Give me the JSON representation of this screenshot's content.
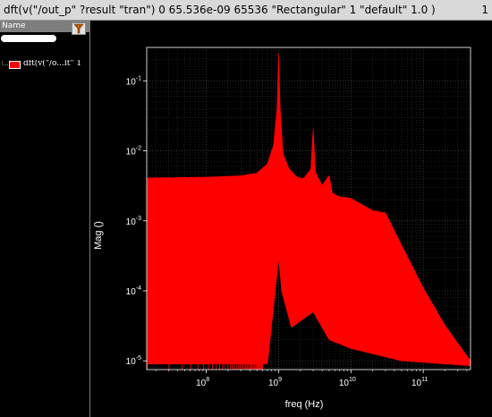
{
  "window": {
    "title": "dft(v(\"/out_p\" ?result \"tran\") 0 65.536e-09 65536 \"Rectangular\" 1 \"default\" 1.0 )",
    "number": "1"
  },
  "panel": {
    "header_label": "Name",
    "traces": [
      {
        "label": "dft(v(\"/o...lt\" 1",
        "color": "#ff0000"
      }
    ]
  },
  "chart_data": {
    "type": "line",
    "xlabel": "freq (Hz)",
    "ylabel": "Mag ()",
    "xscale": "log",
    "yscale": "log",
    "xlim": [
      15000000,
      450000000000
    ],
    "ylim": [
      7.5e-06,
      0.3
    ],
    "grid": true,
    "x_ticks": [
      {
        "value": 100000000,
        "base": "10",
        "exp": "8"
      },
      {
        "value": 1000000000,
        "base": "10",
        "exp": "9"
      },
      {
        "value": 10000000000,
        "base": "10",
        "exp": "10"
      },
      {
        "value": 100000000000,
        "base": "10",
        "exp": "11"
      }
    ],
    "y_ticks": [
      {
        "value": 0.1,
        "base": "10",
        "exp": "-1"
      },
      {
        "value": 0.01,
        "base": "10",
        "exp": "-2"
      },
      {
        "value": 0.001,
        "base": "10",
        "exp": "-3"
      },
      {
        "value": 0.0001,
        "base": "10",
        "exp": "-4"
      },
      {
        "value": 1e-05,
        "base": "10",
        "exp": "-5"
      }
    ],
    "series": [
      {
        "color": "#ff0000",
        "envelope": [
          [
            15300000,
            0.0041
          ],
          [
            100000000,
            0.0042
          ],
          [
            300000000,
            0.0044
          ],
          [
            500000000,
            0.0048
          ],
          [
            700000000,
            0.0065
          ],
          [
            850000000,
            0.012
          ],
          [
            950000000,
            0.04
          ],
          [
            1000000000,
            0.27
          ],
          [
            1050000000,
            0.04
          ],
          [
            1150000000,
            0.009
          ],
          [
            1400000000,
            0.0055
          ],
          [
            1800000000,
            0.0042
          ],
          [
            2200000000,
            0.004
          ],
          [
            2800000000,
            0.0055
          ],
          [
            3000000000,
            0.022
          ],
          [
            3200000000,
            0.005
          ],
          [
            4000000000,
            0.0032
          ],
          [
            5000000000,
            0.0045
          ],
          [
            5500000000,
            0.0025
          ],
          [
            7000000000,
            0.0022
          ],
          [
            10000000000,
            0.0021
          ],
          [
            20000000000,
            0.0014
          ],
          [
            30000000000,
            0.0013
          ],
          [
            50000000000,
            0.00045
          ],
          [
            100000000000,
            0.00011
          ],
          [
            200000000000,
            3.2e-05
          ],
          [
            450000000000,
            1e-05
          ]
        ],
        "floor": [
          [
            15300000,
            9e-06
          ],
          [
            100000000,
            9e-06
          ],
          [
            700000000,
            9e-06
          ],
          [
            900000000,
            0.0001
          ],
          [
            1000000000,
            0.0003
          ],
          [
            1100000000,
            0.0001
          ],
          [
            1500000000,
            3e-05
          ],
          [
            3000000000,
            5e-05
          ],
          [
            5000000000,
            2e-05
          ],
          [
            10000000000,
            1.5e-05
          ],
          [
            50000000000,
            1e-05
          ],
          [
            450000000000,
            8.5e-06
          ]
        ],
        "harmonics": [
          {
            "freq": 3000000000,
            "mag": 0.021
          },
          {
            "freq": 5000000000,
            "mag": 0.0045
          },
          {
            "freq": 7000000000,
            "mag": 0.0025
          },
          {
            "freq": 9000000000,
            "mag": 0.0015
          }
        ]
      }
    ]
  }
}
